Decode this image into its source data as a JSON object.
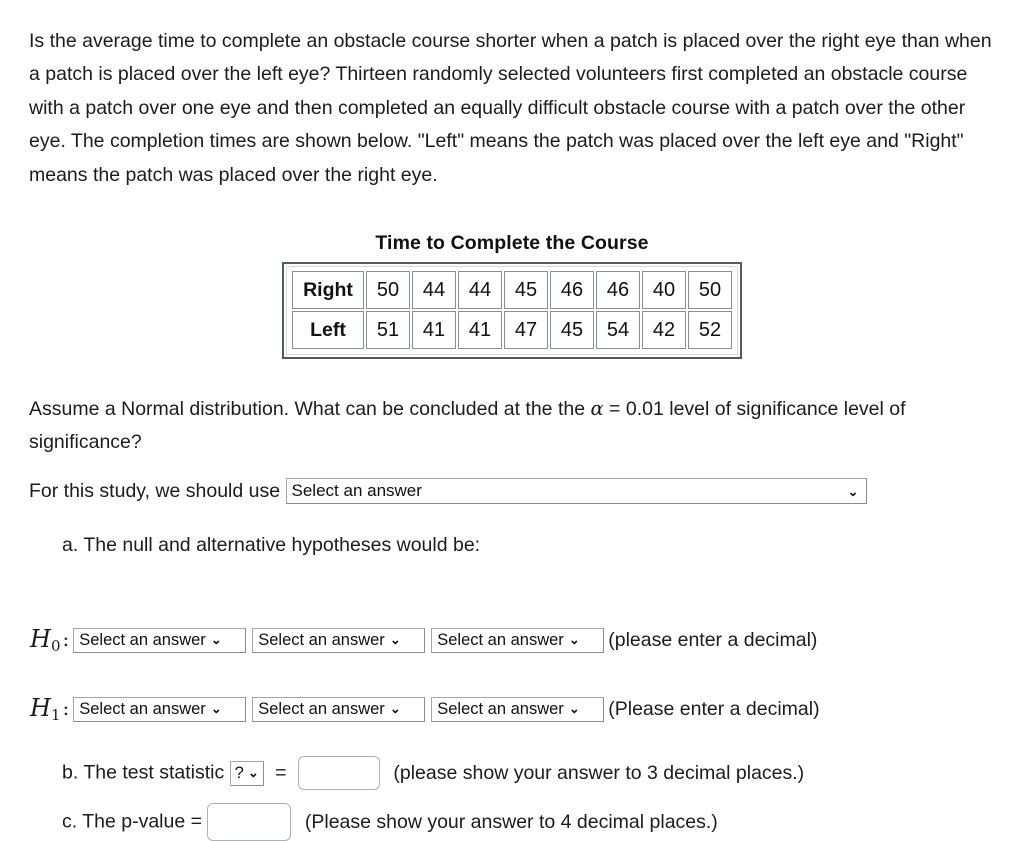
{
  "problem": {
    "intro": "Is the average time to complete an obstacle course shorter when a patch is placed over the right eye than when a patch is placed over the left eye? Thirteen randomly selected volunteers first completed an obstacle course with a patch over one eye and then completed an equally difficult obstacle course with a patch over the other eye. The completion times are shown below. \"Left\" means the patch was placed over the left eye and \"Right\" means the patch was placed over the right eye.",
    "assume_part1": "Assume a Normal distribution.  What can be concluded at the the ",
    "alpha_symbol": "α",
    "assume_part2": " = 0.01 level of significance level of significance?"
  },
  "data_table": {
    "title": "Time to Complete the Course",
    "rows": [
      {
        "label": "Right",
        "values": [
          "50",
          "44",
          "44",
          "45",
          "46",
          "46",
          "40",
          "50"
        ]
      },
      {
        "label": "Left",
        "values": [
          "51",
          "41",
          "41",
          "47",
          "45",
          "54",
          "42",
          "52"
        ]
      }
    ]
  },
  "study_row": {
    "label": "For this study, we should use",
    "select_value": "Select an answer",
    "chevron": "⌄"
  },
  "part_a": {
    "label": "a. The null and alternative hypotheses would be:",
    "h0": {
      "symbol": "H",
      "subscript": "0",
      "colon": ":",
      "selects": [
        "Select an answer",
        "Select an answer",
        "Select an answer"
      ],
      "note": "(please enter a decimal)"
    },
    "h1": {
      "symbol": "H",
      "subscript": "1",
      "colon": ":",
      "selects": [
        "Select an answer",
        "Select an answer",
        "Select an answer"
      ],
      "note": "(Please enter a decimal)"
    }
  },
  "part_b": {
    "label": "b. The test statistic",
    "select_value": "?",
    "equals": "=",
    "input_value": "",
    "note": "(please show your answer to 3 decimal places.)"
  },
  "part_c": {
    "label": "c. The p-value =",
    "input_value": "",
    "note": "(Please show your answer to 4 decimal places.)"
  }
}
